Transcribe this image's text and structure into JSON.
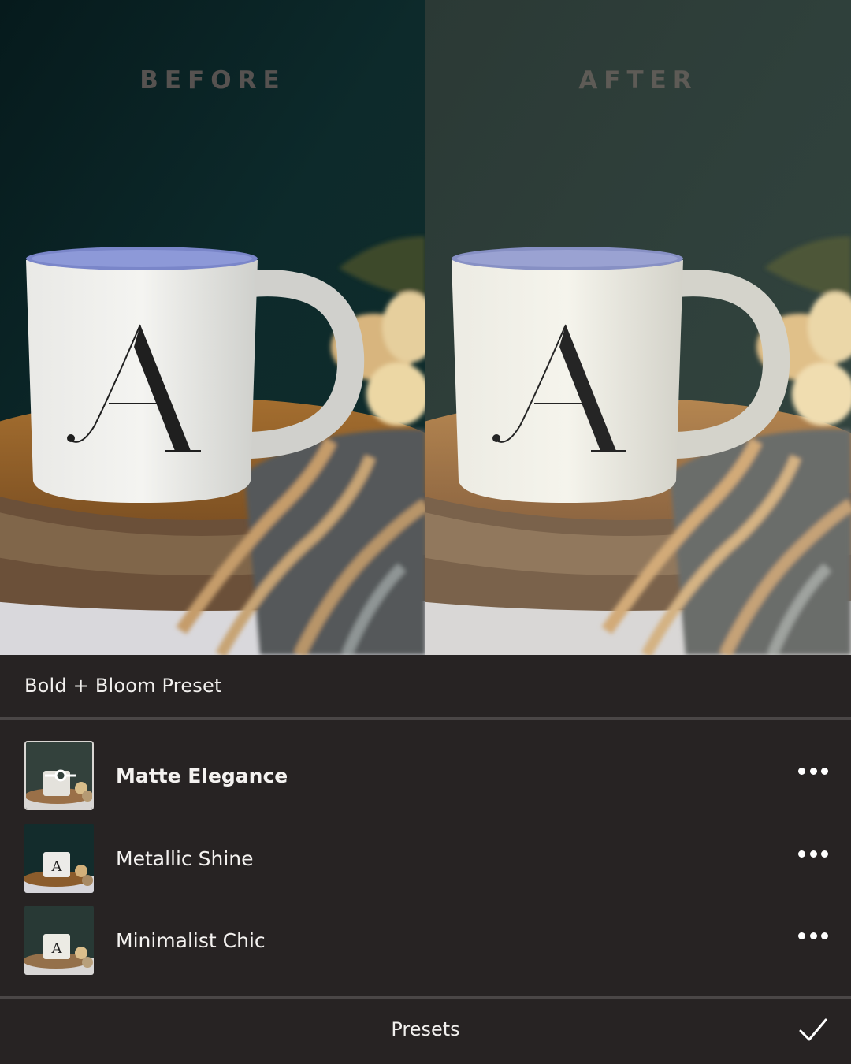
{
  "comparison": {
    "before_label": "BEFORE",
    "after_label": "AFTER",
    "mug_letter": "A"
  },
  "sheet": {
    "title": "Bold + Bloom Preset"
  },
  "presets": [
    {
      "name": "Matte Elegance",
      "selected": true,
      "more_icon": "more-horizontal-icon",
      "overlay_icon": "compare-slider-icon"
    },
    {
      "name": "Metallic Shine",
      "selected": false,
      "more_icon": "more-horizontal-icon"
    },
    {
      "name": "Minimalist Chic",
      "selected": false,
      "more_icon": "more-horizontal-icon"
    }
  ],
  "footer": {
    "label": "Presets",
    "confirm_icon": "checkmark-icon"
  },
  "colors": {
    "sheet_background": "#272323",
    "before_wall": "#0c2426",
    "after_wall": "#2a3a36",
    "text": "#f2f0ee"
  }
}
